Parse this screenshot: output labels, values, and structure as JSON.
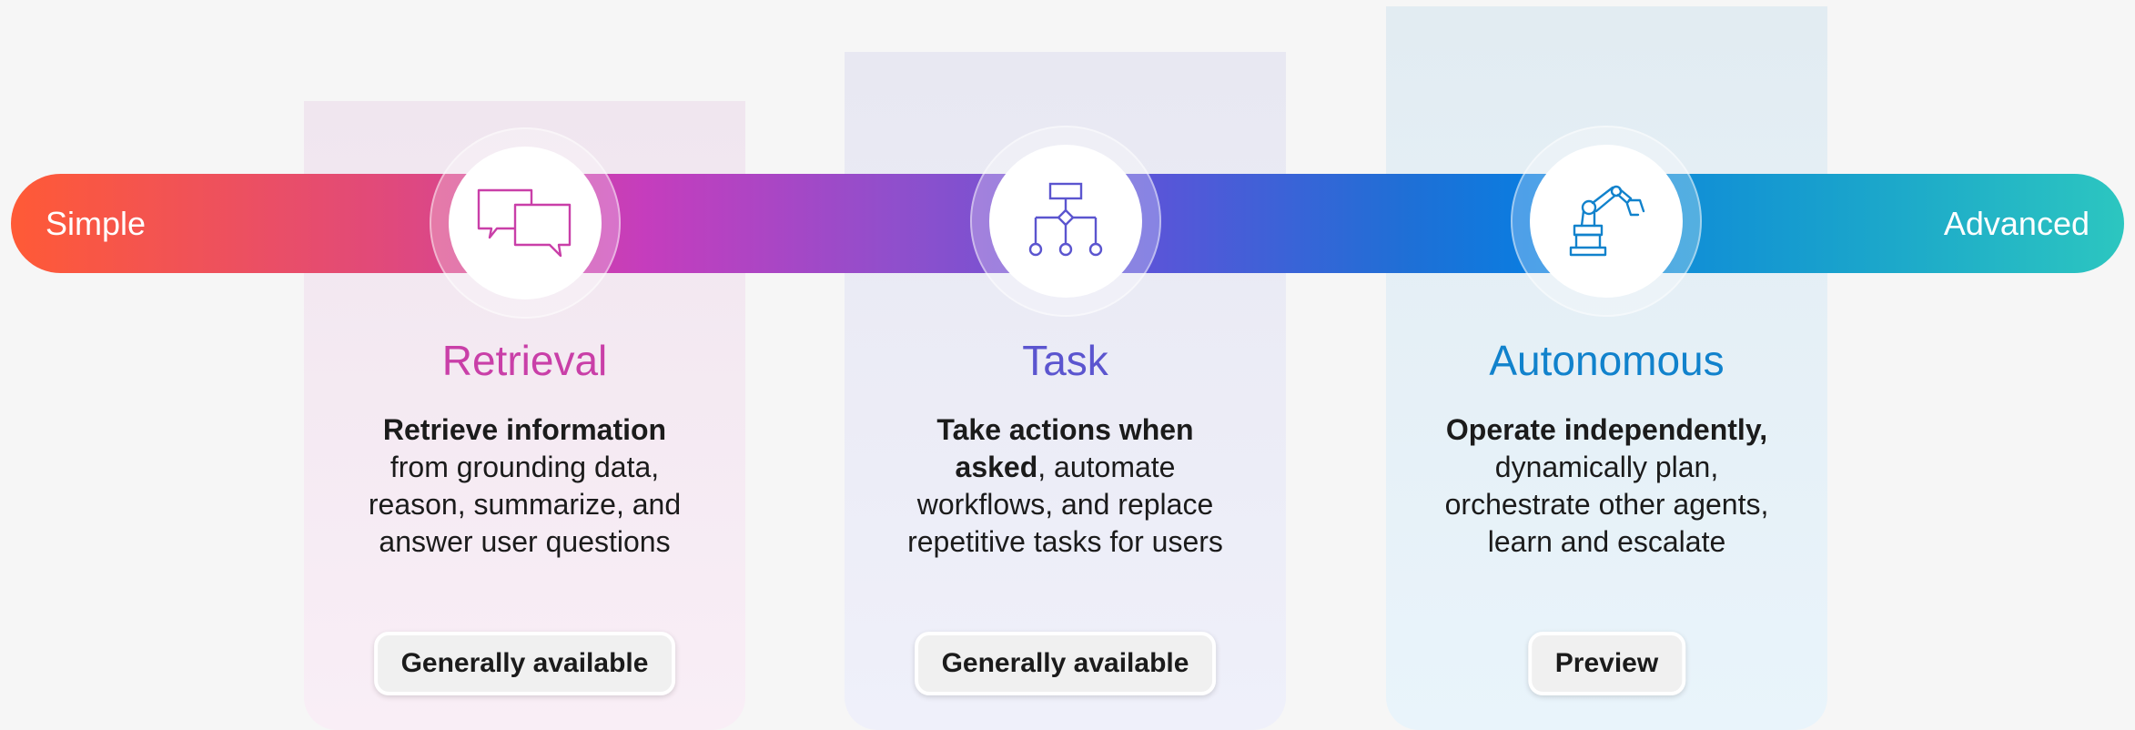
{
  "spectrum": {
    "start_label": "Simple",
    "end_label": "Advanced"
  },
  "colors": {
    "retrieval": "#c93fa8",
    "task": "#5b55cf",
    "autonomous": "#1182cc"
  },
  "cards": [
    {
      "icon": "chat-bubbles-icon",
      "title": "Retrieval",
      "desc_bold": "Retrieve information",
      "desc_rest": "from grounding data, reason, summarize, and answer user questions",
      "status": "Generally available"
    },
    {
      "icon": "workflow-diagram-icon",
      "title": "Task",
      "desc_bold": "Take actions when asked",
      "desc_rest": ", automate workflows, and replace repetitive tasks for users",
      "status": "Generally available"
    },
    {
      "icon": "robot-arm-icon",
      "title": "Autonomous",
      "desc_bold": "Operate independently,",
      "desc_rest": "dynamically plan, orchestrate other agents, learn and escalate",
      "status": "Preview"
    }
  ]
}
